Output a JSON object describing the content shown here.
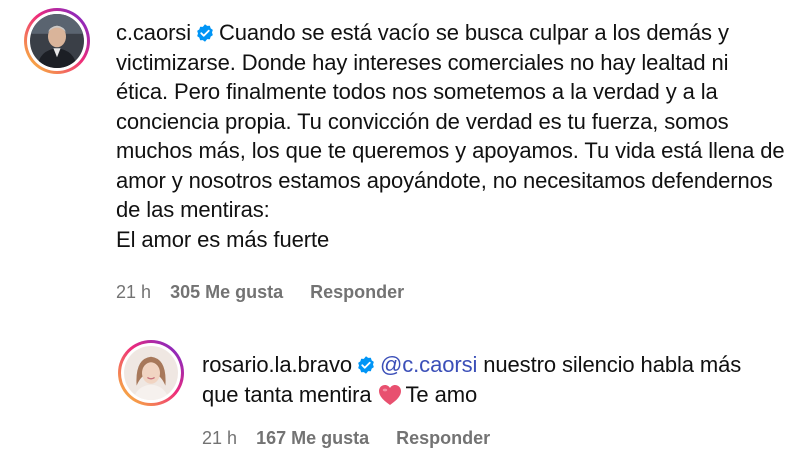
{
  "comments": [
    {
      "username": "c.caorsi",
      "verified": true,
      "text": "Cuando se está vacío se busca culpar a los demás y victimizarse. Donde hay intereses comerciales no hay lealtad ni ética. Pero finalmente todos nos sometemos a la verdad y a la conciencia propia. Tu convicción de verdad es tu fuerza, somos muchos más, los que te queremos y apoyamos. Tu vida está llena de amor y nosotros estamos apoyándote, no necesitamos defendernos de las mentiras:",
      "text_last_line": "El amor es más fuerte",
      "time": "21 h",
      "likes": "305 Me gusta",
      "reply_label": "Responder"
    },
    {
      "username": "rosario.la.bravo",
      "verified": true,
      "mention": "@c.caorsi",
      "text": "nuestro silencio habla más que tanta mentira",
      "text_after_emoji": "Te amo",
      "emoji_icon": "red-heart-icon",
      "time": "21 h",
      "likes": "167 Me gusta",
      "reply_label": "Responder"
    }
  ],
  "colors": {
    "verified": "#0095f6",
    "mention": "#3b4fb8",
    "meta": "#737373",
    "heart": "#e8506f"
  }
}
